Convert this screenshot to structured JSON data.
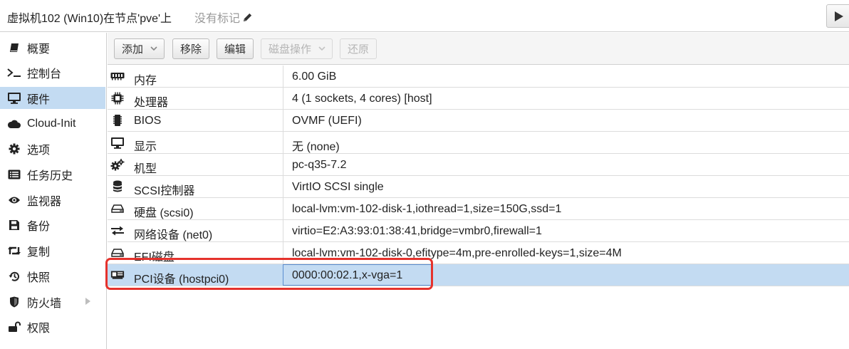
{
  "header": {
    "title": "虚拟机102 (Win10)在节点'pve'上",
    "tags_label": "没有标记",
    "tag_edit_icon": "pencil-icon",
    "start_icon": "play-icon"
  },
  "sidebar": {
    "items": [
      {
        "label": "概要",
        "icon": "book-icon"
      },
      {
        "label": "控制台",
        "icon": "terminal-icon"
      },
      {
        "label": "硬件",
        "icon": "desktop-icon",
        "active": true
      },
      {
        "label": "Cloud-Init",
        "icon": "cloud-icon"
      },
      {
        "label": "选项",
        "icon": "gear-icon"
      },
      {
        "label": "任务历史",
        "icon": "list-icon"
      },
      {
        "label": "监视器",
        "icon": "eye-icon"
      },
      {
        "label": "备份",
        "icon": "floppy-icon"
      },
      {
        "label": "复制",
        "icon": "retweet-icon"
      },
      {
        "label": "快照",
        "icon": "history-icon"
      },
      {
        "label": "防火墙",
        "icon": "shield-icon",
        "has_submenu": true
      },
      {
        "label": "权限",
        "icon": "unlock-icon"
      }
    ]
  },
  "toolbar": {
    "add_label": "添加",
    "remove_label": "移除",
    "edit_label": "编辑",
    "disk_action_label": "磁盘操作",
    "revert_label": "还原"
  },
  "hardware": {
    "rows": [
      {
        "name": "内存",
        "value": "6.00 GiB",
        "icon": "memory-icon"
      },
      {
        "name": "处理器",
        "value": "4 (1 sockets, 4 cores) [host]",
        "icon": "cpu-icon"
      },
      {
        "name": "BIOS",
        "value": "OVMF (UEFI)",
        "icon": "microchip-icon"
      },
      {
        "name": "显示",
        "value": "无 (none)",
        "icon": "monitor-icon"
      },
      {
        "name": "机型",
        "value": "pc-q35-7.2",
        "icon": "cogs-icon"
      },
      {
        "name": "SCSI控制器",
        "value": "VirtIO SCSI single",
        "icon": "database-icon"
      },
      {
        "name": "硬盘 (scsi0)",
        "value": "local-lvm:vm-102-disk-1,iothread=1,size=150G,ssd=1",
        "icon": "hdd-icon"
      },
      {
        "name": "网络设备 (net0)",
        "value": "virtio=E2:A3:93:01:38:41,bridge=vmbr0,firewall=1",
        "icon": "exchange-icon"
      },
      {
        "name": "EFI磁盘",
        "value": "local-lvm:vm-102-disk-0,efitype=4m,pre-enrolled-keys=1,size=4M",
        "icon": "hdd-icon"
      },
      {
        "name": "PCI设备 (hostpci0)",
        "value": "0000:00:02.1,x-vga=1",
        "icon": "pci-card-icon",
        "selected": true
      }
    ]
  },
  "colors": {
    "selection": "#c3dbf2",
    "annotation_border": "#e5322c"
  }
}
